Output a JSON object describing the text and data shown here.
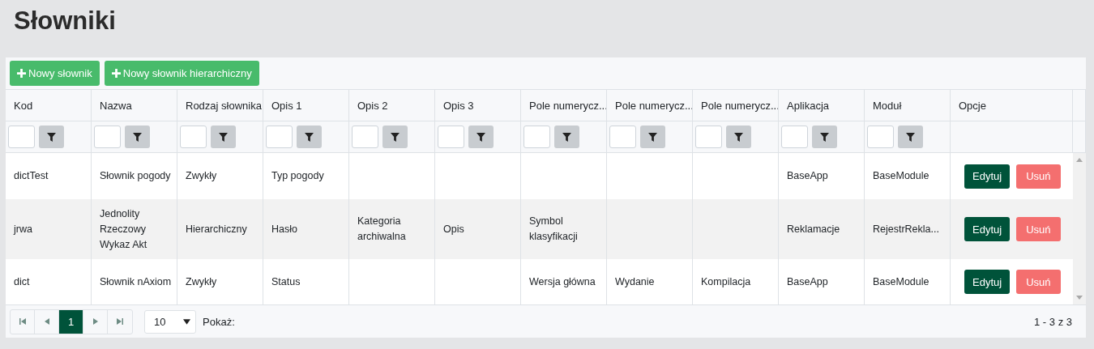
{
  "title": "Słowniki",
  "toolbar": {
    "buttons": [
      {
        "label": "Nowy słownik"
      },
      {
        "label": "Nowy słownik hierarchiczny"
      }
    ]
  },
  "table": {
    "columns": [
      {
        "label": "Kod",
        "filterable": true
      },
      {
        "label": "Nazwa",
        "filterable": true
      },
      {
        "label": "Rodzaj słownika",
        "filterable": true
      },
      {
        "label": "Opis 1",
        "filterable": true
      },
      {
        "label": "Opis 2",
        "filterable": true
      },
      {
        "label": "Opis 3",
        "filterable": true
      },
      {
        "label": "Pole numerycz...",
        "filterable": true
      },
      {
        "label": "Pole numerycz...",
        "filterable": true
      },
      {
        "label": "Pole numerycz...",
        "filterable": true
      },
      {
        "label": "Aplikacja",
        "filterable": true
      },
      {
        "label": "Moduł",
        "filterable": true
      },
      {
        "label": "Opcje",
        "filterable": false
      }
    ],
    "rows": [
      {
        "cells": [
          "dictTest",
          "Słownik pogody",
          "Zwykły",
          "Typ pogody",
          null,
          null,
          null,
          null,
          null,
          "BaseApp",
          "BaseModule"
        ],
        "edit": "Edytuj",
        "delete": "Usuń"
      },
      {
        "cells": [
          "jrwa",
          "Jednolity Rzeczowy Wykaz Akt",
          "Hierarchiczny",
          "Hasło",
          "Kategoria archiwalna",
          "Opis",
          "Symbol klasyfikacji",
          null,
          null,
          "Reklamacje",
          "RejestrRekla..."
        ],
        "edit": "Edytuj",
        "delete": "Usuń"
      },
      {
        "cells": [
          "dict",
          "Słownik nAxiom",
          "Zwykły",
          "Status",
          null,
          null,
          "Wersja główna",
          "Wydanie",
          "Kompilacja",
          "BaseApp",
          "BaseModule"
        ],
        "edit": "Edytuj",
        "delete": "Usuń"
      }
    ]
  },
  "pager": {
    "pages": [
      {
        "label": "1",
        "selected": true
      }
    ],
    "page_size": "10",
    "page_size_label": "Pokaż:",
    "summary": "1 - 3 z 3"
  }
}
